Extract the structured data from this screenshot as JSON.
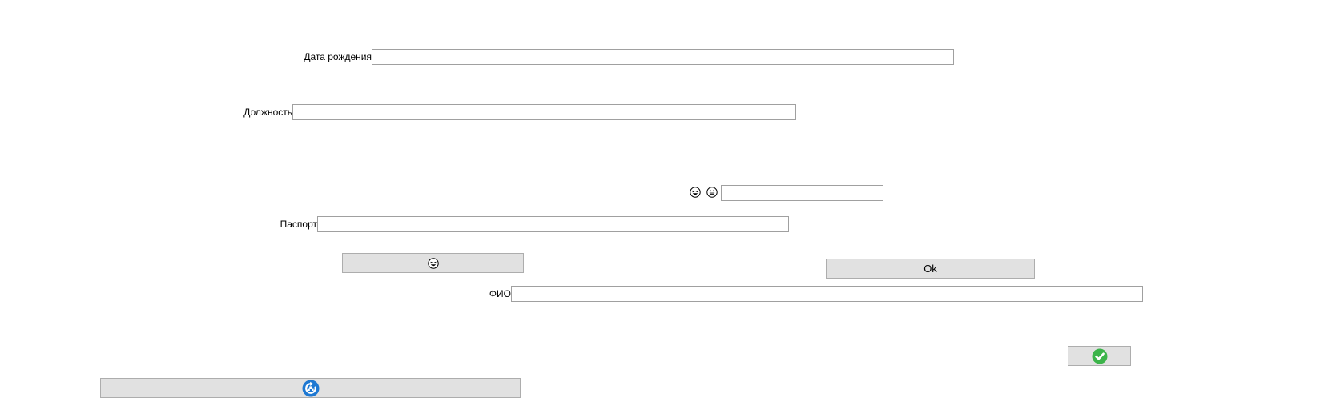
{
  "form": {
    "birth_date": {
      "label": "Дата рождения",
      "value": ""
    },
    "position": {
      "label": "Должность",
      "value": ""
    },
    "emoji_field": {
      "value": "",
      "icons": [
        "grinning-squint-icon",
        "grinning-face-icon"
      ]
    },
    "passport": {
      "label": "Паспорт",
      "value": ""
    },
    "full_name": {
      "label": "ФИО",
      "value": ""
    }
  },
  "buttons": {
    "emoji_button": {
      "icon": "grinning-squint-icon"
    },
    "ok_button": {
      "label": "Ok"
    },
    "confirm_button": {
      "icon": "green-check-icon"
    },
    "refresh_button": {
      "icon": "blue-refresh-icon"
    }
  },
  "colors": {
    "button_bg": "#e1e1e1",
    "button_border": "#adadad",
    "field_border": "#a0a0a0",
    "check_green": "#3cb44a",
    "refresh_blue": "#1e78d2"
  }
}
